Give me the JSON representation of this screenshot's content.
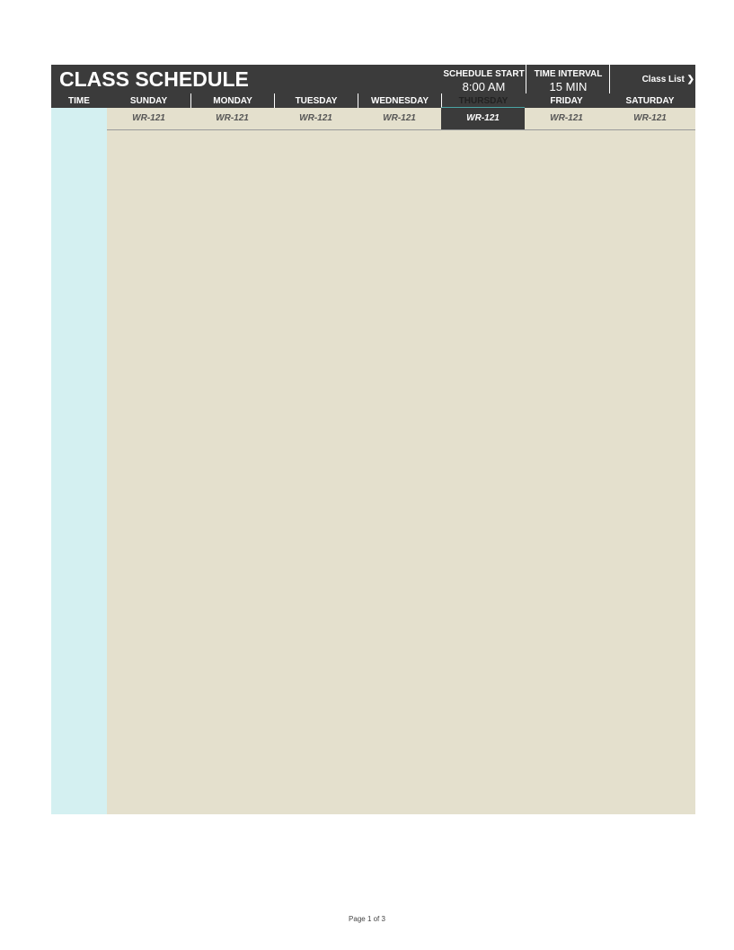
{
  "title": "CLASS SCHEDULE",
  "schedule_start": {
    "label": "SCHEDULE START",
    "value": "8:00 AM"
  },
  "time_interval": {
    "label": "TIME INTERVAL",
    "value": "15 MIN"
  },
  "class_list_link": {
    "label": "Class List",
    "icon": "chevron-right-icon"
  },
  "time_header": "TIME",
  "days": [
    "SUNDAY",
    "MONDAY",
    "TUESDAY",
    "WEDNESDAY",
    "THURSDAY",
    "FRIDAY",
    "SATURDAY"
  ],
  "rooms": [
    "WR-121",
    "WR-121",
    "WR-121",
    "WR-121",
    "WR-121",
    "WR-121",
    "WR-121"
  ],
  "selected_day_index": 4,
  "colors": {
    "header": "#3b3b3b",
    "time_column": "#d4f0f1",
    "grid": "#e4e0cd"
  },
  "footer": "Page 1 of 3"
}
